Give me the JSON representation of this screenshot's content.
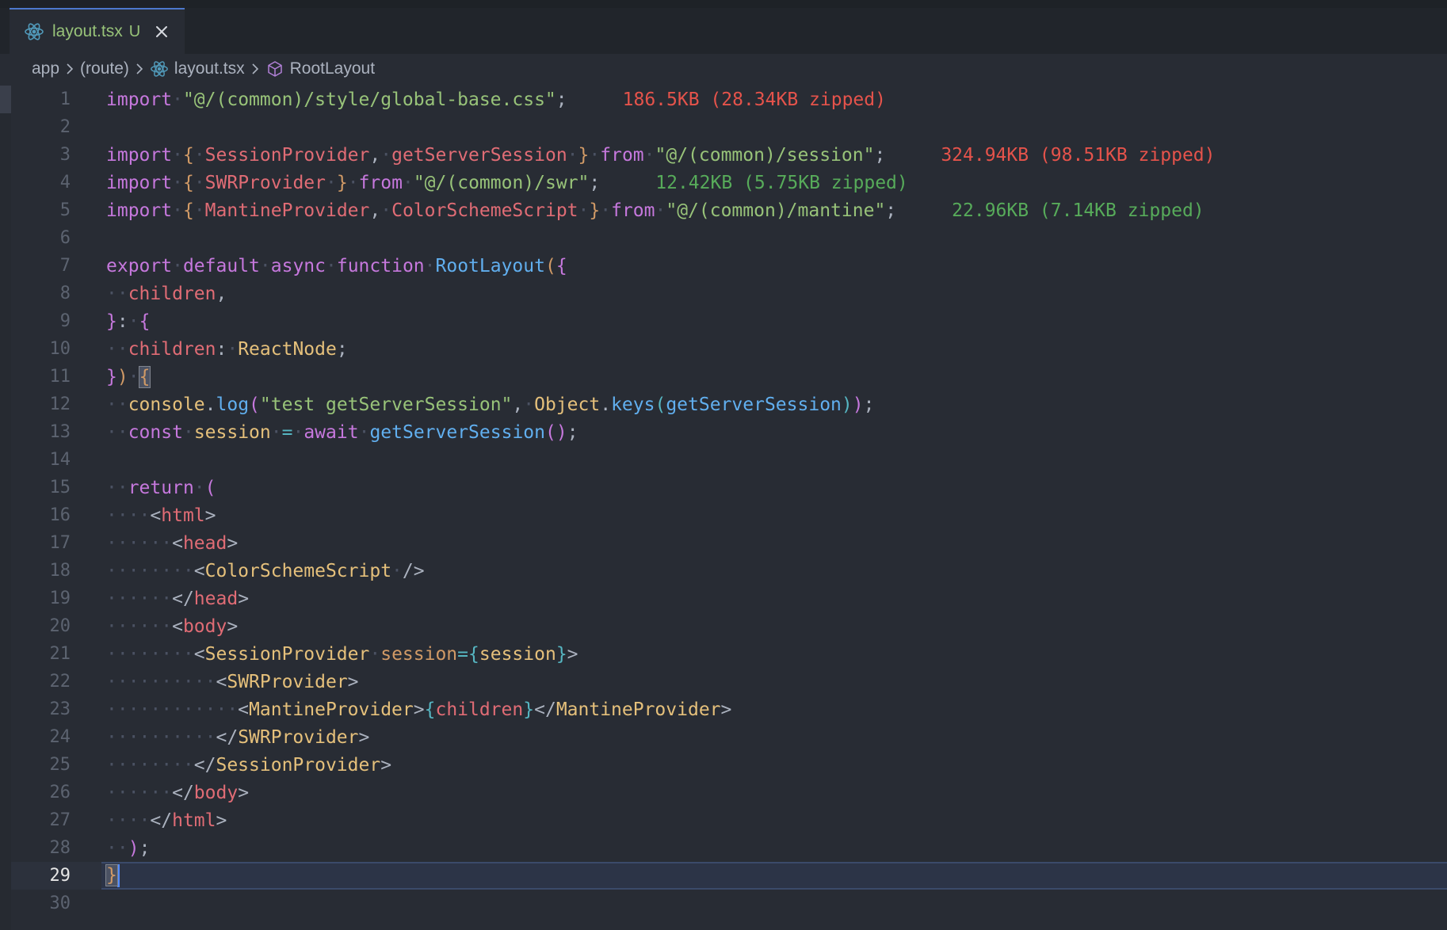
{
  "tab": {
    "filename": "layout.tsx",
    "status": "U",
    "icon": "react-icon",
    "close_icon": "close-icon"
  },
  "breadcrumb": {
    "items": [
      "app",
      "(route)",
      "layout.tsx",
      "RootLayout"
    ]
  },
  "editor": {
    "current_line": 29,
    "line_numbers": [
      "1",
      "2",
      "3",
      "4",
      "5",
      "6",
      "7",
      "8",
      "9",
      "10",
      "11",
      "12",
      "13",
      "14",
      "15",
      "16",
      "17",
      "18",
      "19",
      "20",
      "21",
      "22",
      "23",
      "24",
      "25",
      "26",
      "27",
      "28",
      "29",
      "30"
    ],
    "import_sizes": {
      "line1": "186.5KB (28.34KB zipped)",
      "line3": "324.94KB (98.51KB zipped)",
      "line4": "12.42KB (5.75KB zipped)",
      "line5": "22.96KB (7.14KB zipped)"
    },
    "code": {
      "l1_kw": "import",
      "l1_str": "\"@/(common)/style/global-base.css\"",
      "l3_kw": "import",
      "l3_a": "SessionProvider",
      "l3_b": "getServerSession",
      "l3_from": "from",
      "l3_str": "\"@/(common)/session\"",
      "l4_kw": "import",
      "l4_a": "SWRProvider",
      "l4_from": "from",
      "l4_str": "\"@/(common)/swr\"",
      "l5_kw": "import",
      "l5_a": "MantineProvider",
      "l5_b": "ColorSchemeScript",
      "l5_from": "from",
      "l5_str": "\"@/(common)/mantine\"",
      "l7_export": "export",
      "l7_default": "default",
      "l7_async": "async",
      "l7_function": "function",
      "l7_name": "RootLayout",
      "l8_children": "children",
      "l10_children": "children",
      "l10_type": "ReactNode",
      "l12_console": "console",
      "l12_log": "log",
      "l12_str": "\"test getServerSession\"",
      "l12_object": "Object",
      "l12_keys": "keys",
      "l12_arg": "getServerSession",
      "l13_const": "const",
      "l13_session": "session",
      "l13_await": "await",
      "l13_fn": "getServerSession",
      "l15_return": "return",
      "l16_tag": "html",
      "l17_tag": "head",
      "l18_tag": "ColorSchemeScript",
      "l19_tag": "head",
      "l20_tag": "body",
      "l21_tag": "SessionProvider",
      "l21_attr": "session",
      "l21_val": "session",
      "l22_tag": "SWRProvider",
      "l23_tag": "MantineProvider",
      "l23_child": "children",
      "l23_close": "MantineProvider",
      "l24_tag": "SWRProvider",
      "l25_tag": "SessionProvider",
      "l26_tag": "body",
      "l27_tag": "html"
    }
  },
  "colors": {
    "accent": "#4d78cc",
    "size_large": "#e5534b",
    "size_small": "#57ab5a",
    "modified_status": "#98c379"
  }
}
